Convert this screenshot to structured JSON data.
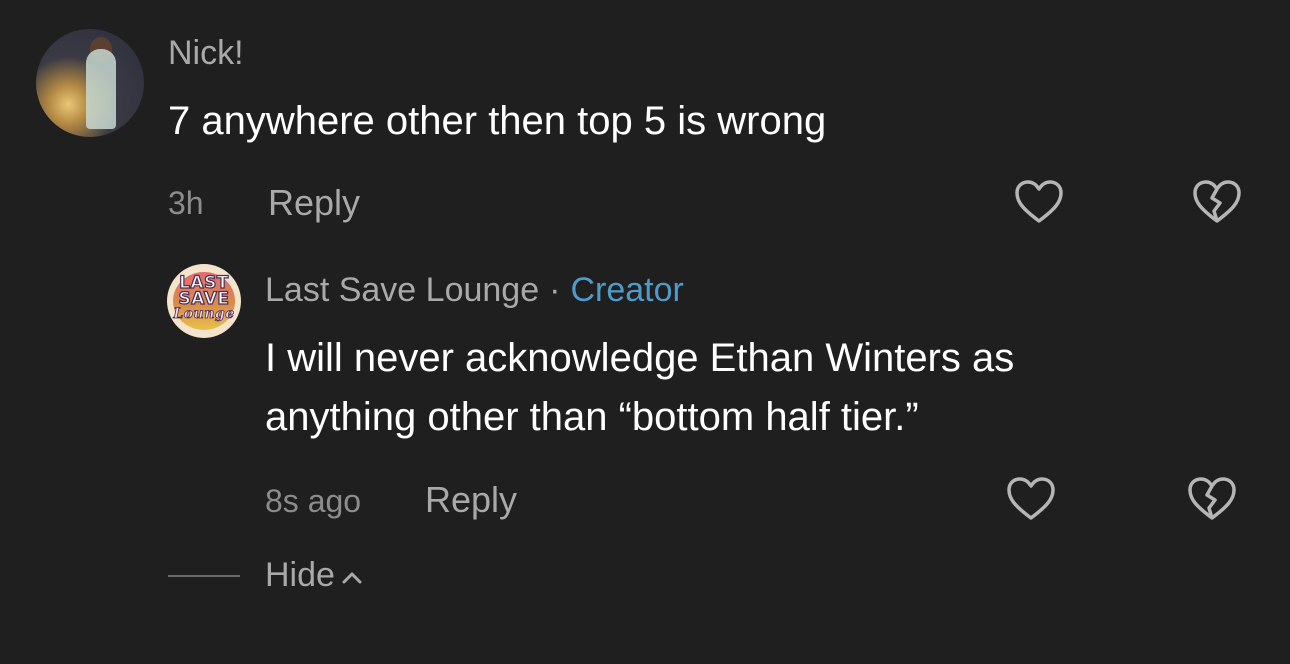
{
  "comments": [
    {
      "username": "Nick!",
      "text": "7 anywhere other then top 5 is wrong",
      "time": "3h",
      "reply_label": "Reply",
      "like_icon": "heart-outline-icon",
      "dislike_icon": "broken-heart-icon"
    },
    {
      "username": "Last Save Lounge",
      "separator": "·",
      "badge": "Creator",
      "badge_color": "#4f9bc9",
      "text_line1": "I will never acknowledge Ethan Winters as",
      "text_line2": "anything other than “bottom half tier.”",
      "time": "8s ago",
      "reply_label": "Reply",
      "like_icon": "heart-outline-icon",
      "dislike_icon": "broken-heart-icon",
      "avatar_logo": {
        "line1": "LAST",
        "line2": "SAVE",
        "line3": "Lounge"
      }
    }
  ],
  "thread": {
    "hide_label": "Hide",
    "hide_icon": "chevron-up-icon"
  },
  "colors": {
    "background": "#1f1f1f",
    "creator_accent": "#4f9bc9"
  }
}
